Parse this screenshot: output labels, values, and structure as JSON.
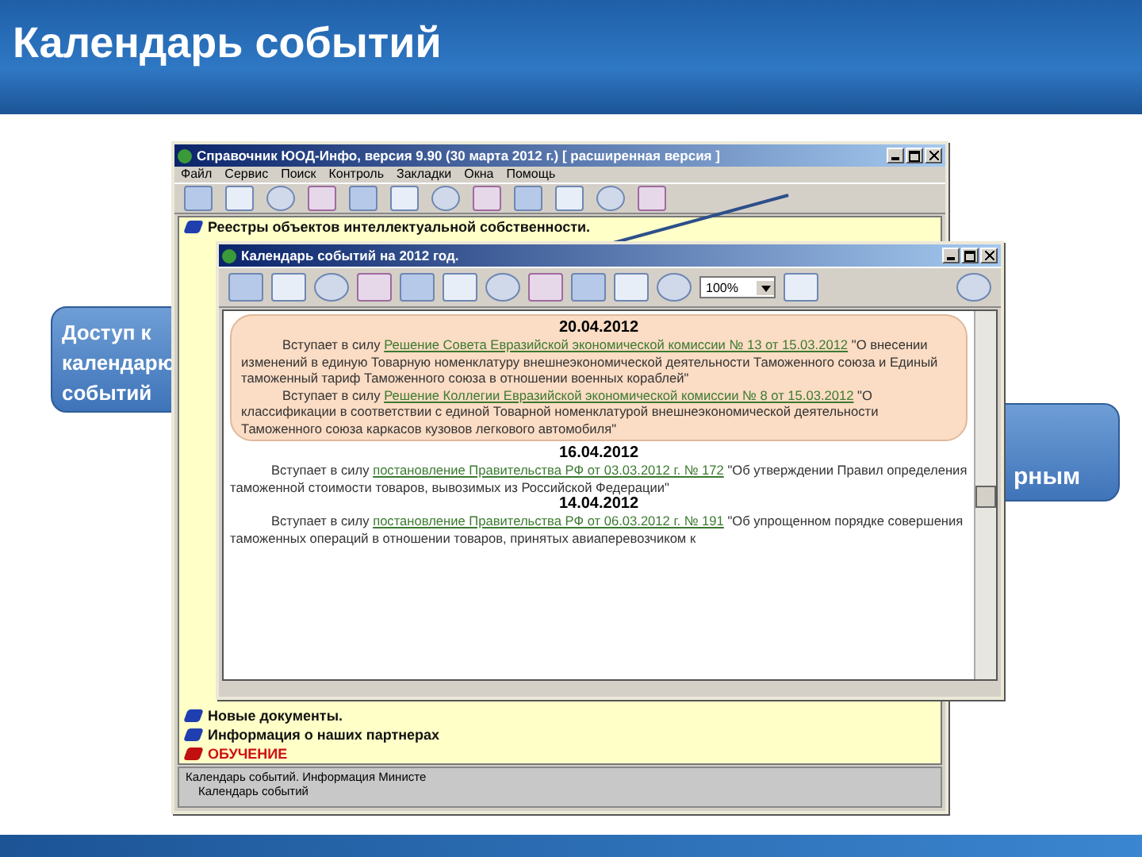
{
  "slide": {
    "title": "Календарь событий"
  },
  "callouts": [
    {
      "kind": "left",
      "text": "Доступ к календарю событий"
    },
    {
      "kind": "right",
      "text": "рным"
    }
  ],
  "main_window": {
    "title": "Справочник ЮОД-Инфо, версия 9.90 (30 марта 2012 г.)  [ расширенная версия ]",
    "menu": [
      "Файл",
      "Сервис",
      "Поиск",
      "Контроль",
      "Закладки",
      "Окна",
      "Помощь"
    ],
    "list_top": [
      {
        "label": "Реестры объектов интеллектуальной собственности.",
        "kind": "normal"
      }
    ],
    "list_bottom": [
      {
        "label": "Новые документы.",
        "kind": "normal"
      },
      {
        "label": "Информация о наших партнерах",
        "kind": "normal"
      },
      {
        "label": "ОБУЧЕНИЕ",
        "kind": "alert"
      }
    ],
    "status_lines": [
      "Календарь событий. Информация Министе",
      "Календарь событий"
    ]
  },
  "calendar_window": {
    "title": "Календарь событий на 2012 год.",
    "zoom": "100%",
    "days": [
      {
        "date": "20.04.2012",
        "highlighted": true,
        "items": [
          {
            "before": "Вступает в силу ",
            "link": "Решение Совета Евразийской экономической комиссии № 13 от 15.03.2012",
            "after": " \"О внесении изменений в единую Товарную номенклатуру внешнеэкономической деятельности Таможенного союза и Единый таможенный тариф Таможенного союза в отношении военных кораблей\""
          },
          {
            "before": "Вступает в силу ",
            "link": "Решение Коллегии Евразийской экономической комиссии № 8 от 15.03.2012",
            "after": " \"О классификации в соответствии с единой Товарной номенклатурой внешнеэкономической деятельности Таможенного союза каркасов кузовов легкового автомобиля\""
          }
        ]
      },
      {
        "date": "16.04.2012",
        "highlighted": false,
        "items": [
          {
            "before": "Вступает в силу ",
            "link": "постановление Правительства РФ от 03.03.2012 г. № 172",
            "after": " \"Об утверждении Правил определения таможенной стоимости товаров, вывозимых из Российской Федерации\""
          }
        ]
      },
      {
        "date": "14.04.2012",
        "highlighted": false,
        "items": [
          {
            "before": "Вступает в силу ",
            "link": "постановление Правительства РФ от 06.03.2012 г. № 191",
            "after": " \"Об упрощенном порядке совершения таможенных операций в отношении товаров, принятых авиаперевозчиком к"
          }
        ]
      }
    ]
  }
}
